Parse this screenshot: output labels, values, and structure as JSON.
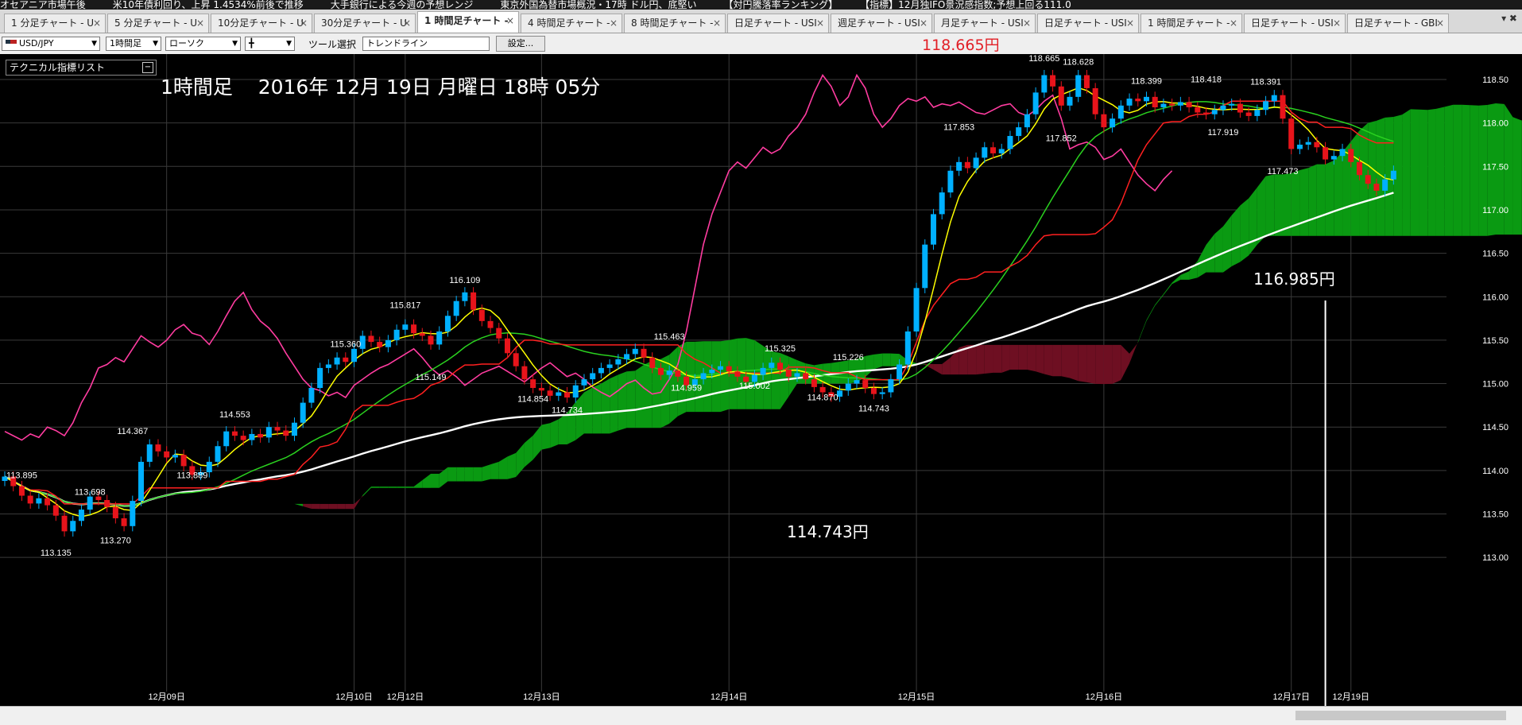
{
  "ticker": [
    "オセアニア市場午後",
    "米10年債利回り、上昇 1.4534%前後で推移",
    "大手銀行による今週の予想レンジ",
    "東京外国為替市場概況・17時 ドル円、底堅い",
    "【対円騰落率ランキング】",
    "【指標】12月独IFO景況感指数;予想上回る111.0"
  ],
  "tabs": [
    {
      "label": "1 分足チャート - U",
      "active": false
    },
    {
      "label": "5 分足チャート - U",
      "active": false
    },
    {
      "label": "10分足チャート - U",
      "active": false
    },
    {
      "label": "30分足チャート - U",
      "active": false
    },
    {
      "label": "1 時間足チャート -",
      "active": true
    },
    {
      "label": "4 時間足チャート -",
      "active": false
    },
    {
      "label": "8 時間足チャート -",
      "active": false
    },
    {
      "label": "日足チャート - USI",
      "active": false
    },
    {
      "label": "週足チャート - USI",
      "active": false
    },
    {
      "label": "月足チャート - USI",
      "active": false
    },
    {
      "label": "日足チャート - USI",
      "active": false
    },
    {
      "label": "1 時間足チャート -",
      "active": false
    },
    {
      "label": "日足チャート - USI",
      "active": false
    },
    {
      "label": "日足チャート - GBI",
      "active": false
    }
  ],
  "tab_close": "×",
  "tab_menu": "▾ ✖",
  "toolbar": {
    "pair": "USD/JPY",
    "timeframe": "1時間足",
    "chart_style": "ローソク",
    "candle_glyph": "╋",
    "tool_label": "ツール選択",
    "tool_value": "トレンドライン",
    "settings": "設定..."
  },
  "current_price_label": "118.665円",
  "indicator_panel": {
    "label": "テクニカル指標リスト",
    "collapse": "−"
  },
  "chart_title": "1時間足    2016年 12月 19日 月曜日 18時 05分",
  "annotations": {
    "low": "114.743円",
    "current": "116.985円"
  },
  "colors": {
    "bg": "#000000",
    "grid": "#3a3a3a",
    "up": "#00b0ff",
    "down": "#e8141b",
    "cloud_green": "#0a9a12",
    "cloud_teal": "#16a3a8",
    "cloud_maroon": "#6e0f22",
    "cloud_navy": "#24306e",
    "ma_white": "#ffffff",
    "ma_yellow": "#ffff00",
    "ma_red": "#ff2020",
    "ma_green": "#2ad11f",
    "lag_pink": "#ff3ca0",
    "thin_cyan": "#36c8e6"
  },
  "chart_data": {
    "type": "candlestick",
    "symbol": "USD/JPY",
    "timeframe": "1時間足",
    "ylim": [
      112.9,
      118.9
    ],
    "y_ticks": [
      "113.00",
      "113.50",
      "114.00",
      "114.50",
      "115.00",
      "115.50",
      "116.00",
      "116.50",
      "117.00",
      "117.50",
      "118.00",
      "118.50"
    ],
    "x_labels": [
      {
        "text": "12月09日",
        "index": 19
      },
      {
        "text": "12月10日",
        "index": 41
      },
      {
        "text": "12月12日",
        "index": 47
      },
      {
        "text": "12月13日",
        "index": 63
      },
      {
        "text": "12月14日",
        "index": 85
      },
      {
        "text": "12月15日",
        "index": 107
      },
      {
        "text": "12月16日",
        "index": 129
      },
      {
        "text": "12月17日",
        "index": 151
      },
      {
        "text": "12月19日",
        "index": 158
      }
    ],
    "marker_index": 155,
    "price_labels": [
      {
        "text": "113.895",
        "index": 2,
        "price": 113.91
      },
      {
        "text": "113.698",
        "index": 10,
        "price": 113.72
      },
      {
        "text": "113.135",
        "index": 6,
        "price": 113.02
      },
      {
        "text": "113.270",
        "index": 13,
        "price": 113.16
      },
      {
        "text": "114.367",
        "index": 15,
        "price": 114.42
      },
      {
        "text": "113.889",
        "index": 22,
        "price": 113.91
      },
      {
        "text": "114.553",
        "index": 27,
        "price": 114.61
      },
      {
        "text": "115.360",
        "index": 40,
        "price": 115.42
      },
      {
        "text": "115.149",
        "index": 50,
        "price": 115.04
      },
      {
        "text": "115.817",
        "index": 47,
        "price": 115.87
      },
      {
        "text": "116.109",
        "index": 54,
        "price": 116.16
      },
      {
        "text": "114.854",
        "index": 62,
        "price": 114.79
      },
      {
        "text": "114.734",
        "index": 66,
        "price": 114.66
      },
      {
        "text": "115.463",
        "index": 78,
        "price": 115.51
      },
      {
        "text": "114.959",
        "index": 80,
        "price": 114.92
      },
      {
        "text": "115.325",
        "index": 91,
        "price": 115.37
      },
      {
        "text": "115.002",
        "index": 88,
        "price": 114.94
      },
      {
        "text": "115.226",
        "index": 99,
        "price": 115.27
      },
      {
        "text": "114.870",
        "index": 96,
        "price": 114.81
      },
      {
        "text": "114.743",
        "index": 102,
        "price": 114.68
      },
      {
        "text": "117.853",
        "index": 112,
        "price": 117.92
      },
      {
        "text": "118.665",
        "index": 122,
        "price": 118.71
      },
      {
        "text": "118.628",
        "index": 126,
        "price": 118.67
      },
      {
        "text": "117.852",
        "index": 124,
        "price": 117.79
      },
      {
        "text": "118.399",
        "index": 134,
        "price": 118.45
      },
      {
        "text": "118.418",
        "index": 141,
        "price": 118.47
      },
      {
        "text": "118.391",
        "index": 148,
        "price": 118.44
      },
      {
        "text": "117.919",
        "index": 143,
        "price": 117.86
      },
      {
        "text": "117.473",
        "index": 150,
        "price": 117.41
      }
    ],
    "close": [
      113.93,
      113.82,
      113.71,
      113.62,
      113.68,
      113.6,
      113.48,
      113.3,
      113.42,
      113.55,
      113.7,
      113.66,
      113.58,
      113.45,
      113.36,
      113.65,
      114.1,
      114.3,
      114.22,
      114.15,
      114.18,
      114.05,
      113.95,
      113.98,
      114.1,
      114.28,
      114.45,
      114.4,
      114.35,
      114.42,
      114.38,
      114.5,
      114.46,
      114.4,
      114.55,
      114.78,
      114.95,
      115.18,
      115.22,
      115.3,
      115.25,
      115.4,
      115.55,
      115.48,
      115.42,
      115.5,
      115.62,
      115.68,
      115.58,
      115.55,
      115.45,
      115.6,
      115.78,
      115.95,
      116.05,
      115.85,
      115.72,
      115.64,
      115.52,
      115.35,
      115.2,
      115.05,
      114.95,
      114.92,
      114.86,
      114.9,
      114.84,
      114.98,
      115.05,
      115.12,
      115.18,
      115.22,
      115.28,
      115.34,
      115.4,
      115.3,
      115.18,
      115.1,
      115.15,
      115.08,
      114.98,
      115.05,
      115.12,
      115.16,
      115.2,
      115.14,
      115.08,
      115.02,
      115.1,
      115.18,
      115.24,
      115.16,
      115.08,
      115.12,
      115.05,
      114.96,
      114.9,
      114.85,
      114.92,
      115.0,
      115.04,
      114.95,
      114.88,
      114.9,
      115.05,
      115.22,
      115.6,
      116.1,
      116.6,
      116.95,
      117.2,
      117.45,
      117.55,
      117.48,
      117.6,
      117.72,
      117.65,
      117.7,
      117.85,
      117.95,
      118.1,
      118.35,
      118.55,
      118.42,
      118.2,
      118.3,
      118.55,
      118.4,
      118.1,
      117.95,
      118.05,
      118.2,
      118.28,
      118.25,
      118.3,
      118.18,
      118.22,
      118.2,
      118.24,
      118.18,
      118.12,
      118.1,
      118.15,
      118.2,
      118.22,
      118.12,
      118.08,
      118.15,
      118.25,
      118.32,
      118.05,
      117.7,
      117.75,
      117.78,
      117.72,
      117.58,
      117.62,
      117.7,
      117.55,
      117.4,
      117.3,
      117.22,
      117.35,
      117.45
    ]
  }
}
